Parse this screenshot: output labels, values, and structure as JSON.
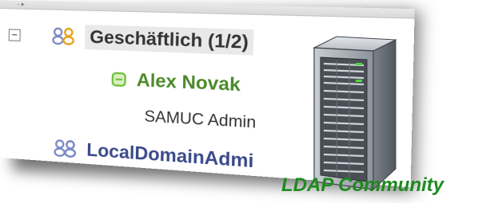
{
  "contact_list": {
    "group_business": {
      "expander": "−",
      "label": "Geschäftlich (1/2)",
      "contacts": [
        {
          "name": "Alex Novak",
          "status": "online",
          "status_color": "#6fbf3a"
        },
        {
          "name": "SAMUC Admin",
          "status": "offline"
        }
      ]
    },
    "group_local": {
      "label": "LocalDomainAdmi"
    }
  },
  "caption": "LDAP Community",
  "colors": {
    "group_icon_front": "#e6a51f",
    "group_icon_back": "#7a86c4",
    "online_green": "#4b8a2a",
    "caption_green": "#1e8a1e",
    "server_gray": "#9aa0a8"
  },
  "icons": {
    "group": "people-icon",
    "status": "status-online-icon",
    "server": "server-icon"
  }
}
